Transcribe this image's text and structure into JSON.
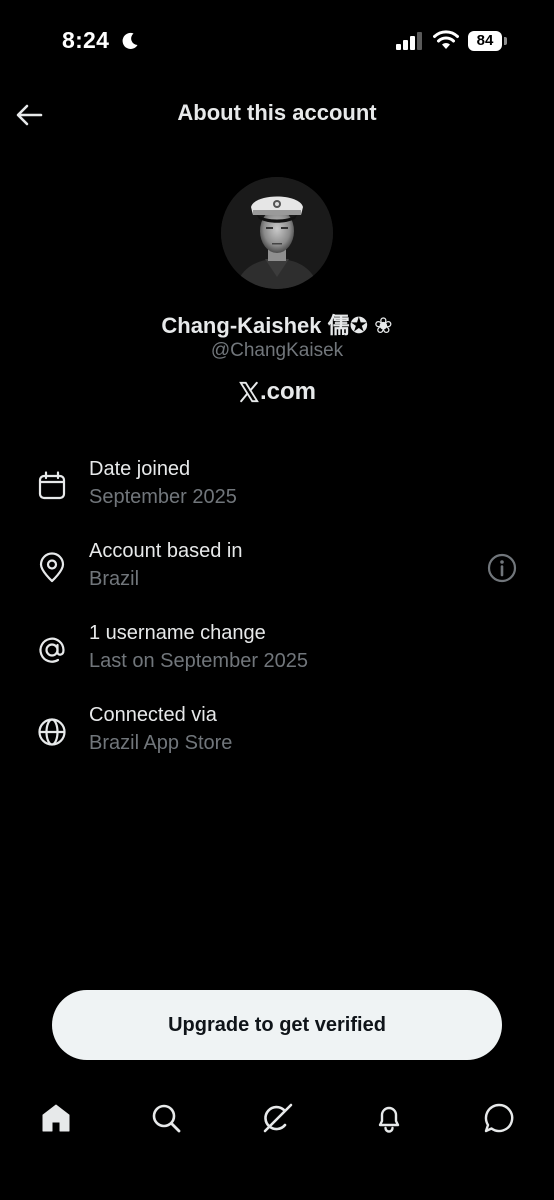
{
  "status_bar": {
    "time": "8:24",
    "battery": "84"
  },
  "header": {
    "title": "About this account"
  },
  "profile": {
    "display_name": "Chang-Kaishek 儒✪ ❀",
    "handle": "@ChangKaisek",
    "affiliation_suffix": ".com"
  },
  "info_items": [
    {
      "icon": "calendar-icon",
      "label": "Date joined",
      "value": "September 2025"
    },
    {
      "icon": "location-pin-icon",
      "label": "Account based in",
      "value": "Brazil"
    },
    {
      "icon": "at-sign-icon",
      "label": "1 username change",
      "value": "Last on September 2025"
    },
    {
      "icon": "globe-icon",
      "label": "Connected via",
      "value": "Brazil App Store"
    }
  ],
  "upgrade_button": {
    "label": "Upgrade to get verified"
  },
  "bottom_nav": {
    "items": [
      "home-icon",
      "search-icon",
      "grok-icon",
      "notifications-bell-icon",
      "messages-icon"
    ]
  }
}
